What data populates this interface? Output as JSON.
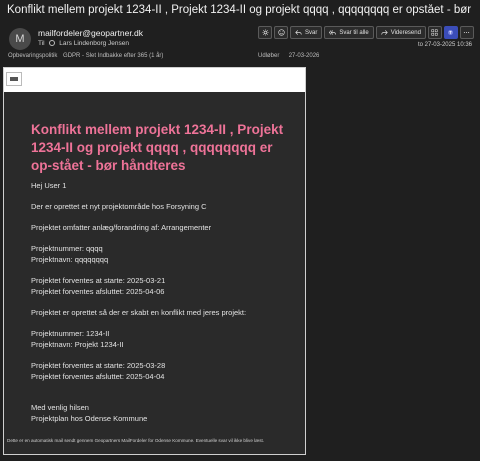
{
  "subject": "Konflikt mellem projekt 1234-II , Projekt 1234-II og projekt qqqq , qqqqqqqq er opstået - bør håndteres",
  "sender": {
    "avatar_letter": "M",
    "address": "mailfordeler@geopartner.dk",
    "to_label": "Til",
    "to_name": "Lars Lindenborg Jensen"
  },
  "meta": {
    "retention_label": "Opbevaringspolitik",
    "retention_value": "GDPR - Slet Indbakke efter 365 (1 år)",
    "expires_label": "Udløber",
    "expires_value": "27-03-2026"
  },
  "date": "to 27-03-2025 10:36",
  "toolbar": {
    "reply": "Svar",
    "reply_all": "Svar til alle",
    "forward": "Videresend"
  },
  "email": {
    "title": "Konflikt mellem projekt 1234-II , Projekt 1234-II og projekt qqqq , qqqqqqqq er op-stået - bør håndteres",
    "greeting": "Hej User 1",
    "l1": "Der er oprettet et nyt projektområde hos Forsyning C",
    "l2": "Projektet omfatter anlæg/forandring af: Arrangementer",
    "l3": "Projektnummer: qqqq",
    "l4": "Projektnavn: qqqqqqqq",
    "l5": "Projektet forventes at starte: 2025-03-21",
    "l6": "Projektet forventes afsluttet: 2025-04-06",
    "l7": "Projektet er oprettet så der er skabt en konflikt med jeres projekt:",
    "l8": "Projektnummer: 1234-II",
    "l9": "Projektnavn: Projekt 1234-II",
    "l10": "Projektet forventes at starte: 2025-03-28",
    "l11": "Projektet forventes afsluttet: 2025-04-04",
    "l12": "Med venlig hilsen",
    "l13": "Projektplan hos Odense Kommune",
    "footer": "Dette er en automatisk mail sendt gennem Geopartners MailFordeler for Odense Kommune. Eventuelle svar vil ikke blive læst."
  }
}
